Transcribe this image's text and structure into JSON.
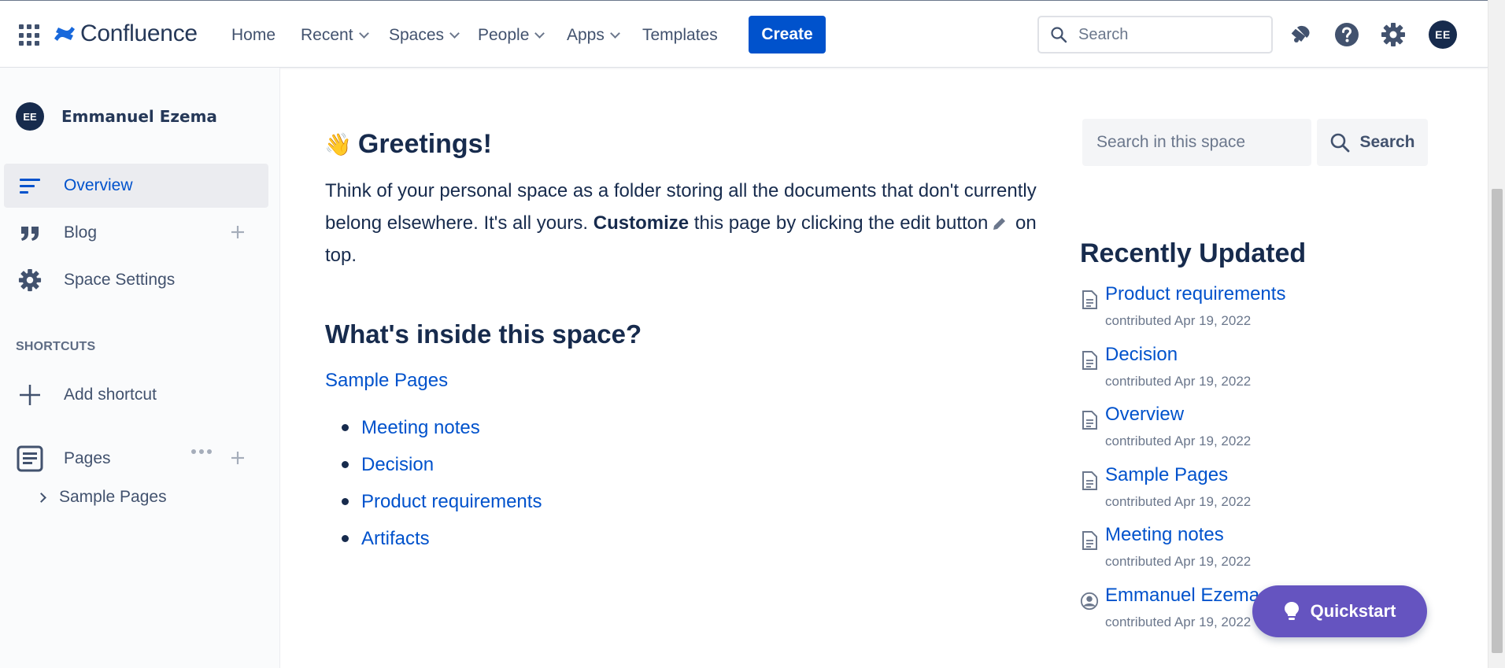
{
  "topnav": {
    "app_name": "Confluence",
    "items": [
      {
        "label": "Home",
        "has_menu": false
      },
      {
        "label": "Recent",
        "has_menu": true
      },
      {
        "label": "Spaces",
        "has_menu": true
      },
      {
        "label": "People",
        "has_menu": true
      },
      {
        "label": "Apps",
        "has_menu": true
      },
      {
        "label": "Templates",
        "has_menu": false
      }
    ],
    "create_label": "Create",
    "search_placeholder": "Search",
    "icons": [
      "notifications-icon",
      "help-icon",
      "settings-icon"
    ],
    "user_initials": "EE"
  },
  "sidebar": {
    "user_initials": "EE",
    "user_name": "Emmanuel Ezema",
    "items": [
      {
        "label": "Overview",
        "icon": "overview-icon",
        "active": true
      },
      {
        "label": "Blog",
        "icon": "quote-icon"
      },
      {
        "label": "Space Settings",
        "icon": "gear-icon"
      }
    ],
    "shortcuts_heading": "SHORTCUTS",
    "add_shortcut_label": "Add shortcut",
    "pages_label": "Pages",
    "tree": [
      {
        "label": "Sample Pages"
      }
    ]
  },
  "main": {
    "greeting_emoji": "👋",
    "greeting": "Greetings!",
    "intro_part1": "Think of your personal space as a folder storing all the documents that don't currently belong elsewhere. It's all yours. ",
    "intro_bold": "Customize",
    "intro_part2": " this page by clicking the edit button",
    "intro_part3": " on top.",
    "section_title": "What's inside this space?",
    "sample_link": "Sample Pages",
    "bullets": [
      "Meeting notes",
      "Decision",
      "Product requirements",
      "Artifacts"
    ]
  },
  "right_panel": {
    "search_placeholder": "Search in this space",
    "search_button": "Search",
    "recently_updated_title": "Recently Updated",
    "items": [
      {
        "title": "Product requirements",
        "meta": "contributed Apr 19, 2022",
        "icon": "page-icon"
      },
      {
        "title": "Decision",
        "meta": "contributed Apr 19, 2022",
        "icon": "page-icon"
      },
      {
        "title": "Overview",
        "meta": "contributed Apr 19, 2022",
        "icon": "page-icon"
      },
      {
        "title": "Sample Pages",
        "meta": "contributed Apr 19, 2022",
        "icon": "page-icon"
      },
      {
        "title": "Meeting notes",
        "meta": "contributed Apr 19, 2022",
        "icon": "page-icon"
      },
      {
        "title": "Emmanuel Ezema",
        "meta": "contributed Apr 19, 2022",
        "icon": "profile-icon"
      }
    ]
  },
  "quickstart_label": "Quickstart",
  "colors": {
    "brand_blue": "#0052cc",
    "text": "#172b4d",
    "quickstart_purple": "#6554c0"
  }
}
